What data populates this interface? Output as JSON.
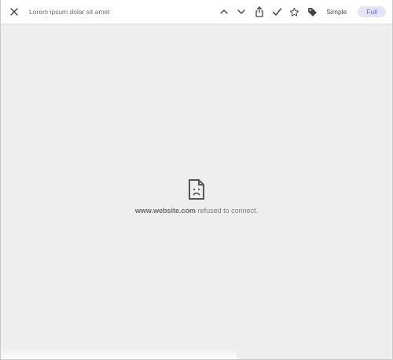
{
  "toolbar": {
    "title": "Lorem ipsum dolar sit amet",
    "icons": {
      "close": "close-icon",
      "up": "chevron-up-icon",
      "down": "chevron-down-icon",
      "share": "share-icon",
      "check": "check-icon",
      "star": "star-icon",
      "tag": "tag-icon"
    },
    "mode_simple": "Simple",
    "mode_full": "Full"
  },
  "content": {
    "error_icon": "broken-page-icon",
    "error_host": "www.website.com",
    "error_message": "refused to connect."
  },
  "colors": {
    "toolbar_bg": "#ffffff",
    "content_bg": "#eeeeee",
    "accent_pill_bg": "#e5e3f7",
    "accent_pill_text": "#6a63c3",
    "icon_color": "#444444"
  }
}
